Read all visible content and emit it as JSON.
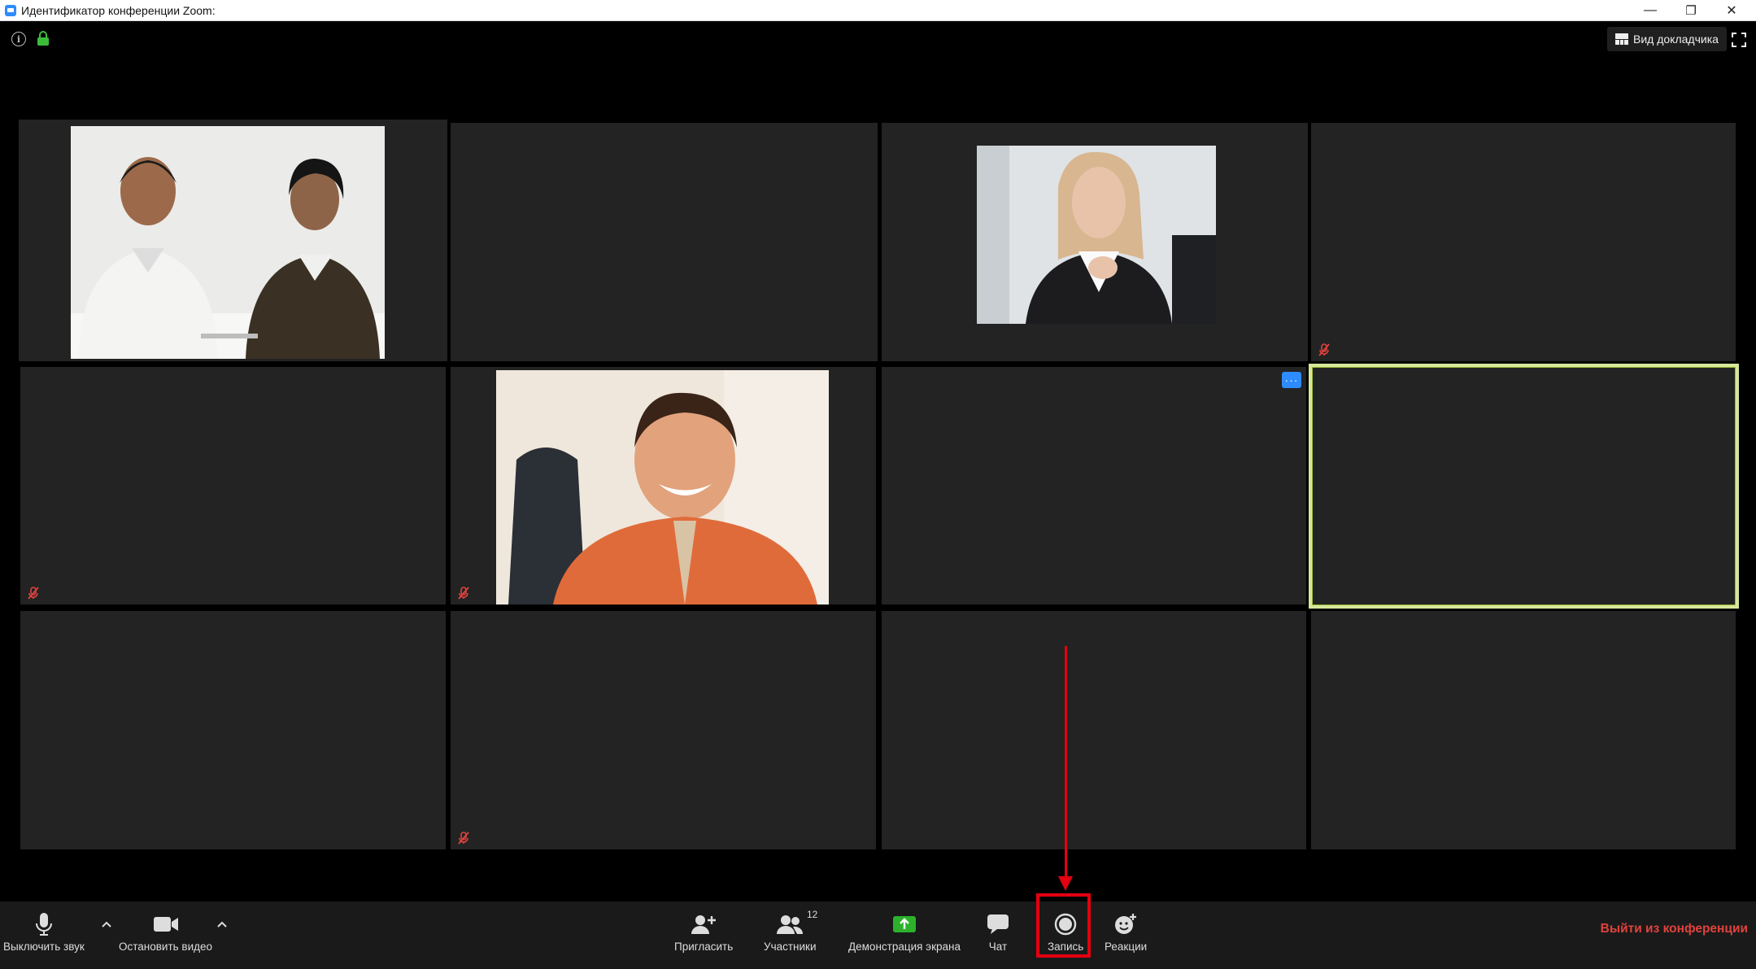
{
  "window": {
    "title": "Идентификатор конференции Zoom: ",
    "minimize": "—",
    "restore": "❐",
    "close": "✕"
  },
  "header": {
    "speaker_view_label": "Вид докладчика"
  },
  "grid": {
    "active_tile_color": "#d7e89a",
    "more_label": "···"
  },
  "toolbar": {
    "mute_label": "Выключить звук",
    "video_label": "Остановить видео",
    "invite_label": "Пригласить",
    "participants_label": "Участники",
    "participants_count": "12",
    "share_label": "Демонстрация экрана",
    "chat_label": "Чат",
    "record_label": "Запись",
    "reactions_label": "Реакции",
    "leave_label": "Выйти из конференции",
    "share_color": "#2db12d",
    "leave_color": "#e0423d"
  },
  "annotation": {
    "color": "#e30010"
  }
}
